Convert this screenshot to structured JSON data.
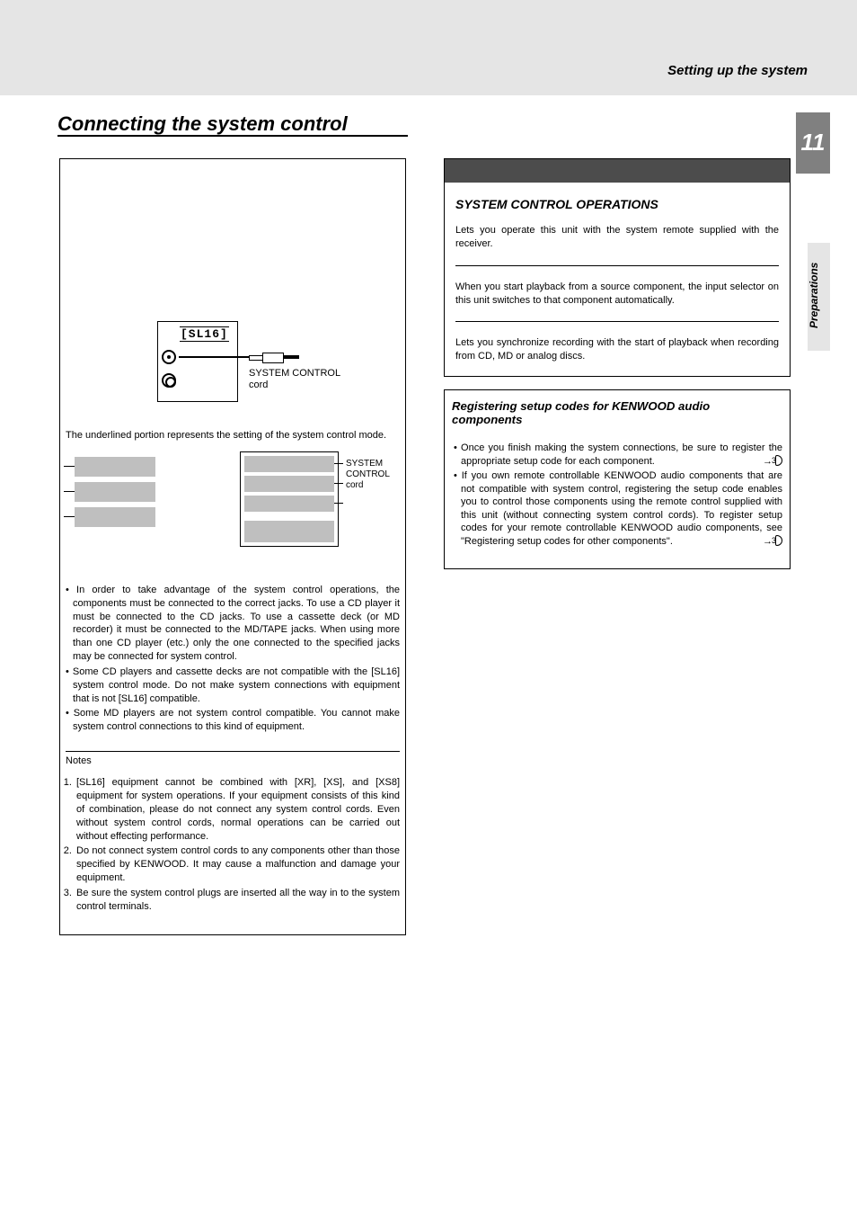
{
  "chapter": "Setting up the system",
  "section_title": "Connecting the system control",
  "page_number": "11",
  "side_tab": "Preparations",
  "left": {
    "diagram": {
      "sl16": "[SL16]",
      "cord_label_1": "SYSTEM CONTROL",
      "cord_label_2": "cord"
    },
    "mode_intro": "The underlined portion represents the setting of the system control mode.",
    "stack_label_1": "SYSTEM",
    "stack_label_2": "CONTROL",
    "stack_label_3": "cord",
    "bullets": [
      "• In order to take advantage of the system control operations, the components must be connected to the correct jacks. To use a CD player it must be connected to the CD jacks. To use a cassette deck (or MD recorder) it must be connected to the MD/TAPE jacks. When using more than one CD player (etc.) only the one connected to the specified jacks may be connected for system control.",
      "• Some CD players and cassette decks are not compatible with the [SL16] system control mode. Do not make system connections with equipment that is not [SL16] compatible.",
      "• Some MD players are not system control compatible. You cannot make system control connections to this kind of equipment."
    ],
    "notes_head": "Notes",
    "notes": [
      "[SL16] equipment cannot be combined with [XR], [XS], and [XS8] equipment for system operations. If your equipment consists of this kind of combination, please do not connect any system control cords. Even without system control cords, normal operations can be carried out without effecting performance.",
      "Do not connect system control cords to any components other than those specified by KENWOOD. It may cause a malfunction and damage your equipment.",
      "Be sure the system control plugs are inserted all the way in to the system control terminals."
    ]
  },
  "right": {
    "ops_head": "SYSTEM CONTROL OPERATIONS",
    "op1": "Lets you operate this unit with the system remote supplied with the receiver.",
    "op2": "When you start playback from a source component, the input selector on this unit switches to that component automatically.",
    "op3": "Lets you synchronize recording with the start of playback when recording from CD, MD or analog discs.",
    "reg_head": "Registering setup codes for KENWOOD audio components",
    "reg1": "• Once you finish making the system connections, be sure to register the appropriate setup code for each component.",
    "reg2": "• If you own remote controllable KENWOOD audio components that are not compatible with system control, registering the setup code enables you to control those components using the remote control supplied with this unit (without connecting system control cords). To register setup codes for your remote controllable KENWOOD audio components, see \"Registering setup codes for other components\".",
    "ref_arrow": "→",
    "ref_page": "3"
  }
}
